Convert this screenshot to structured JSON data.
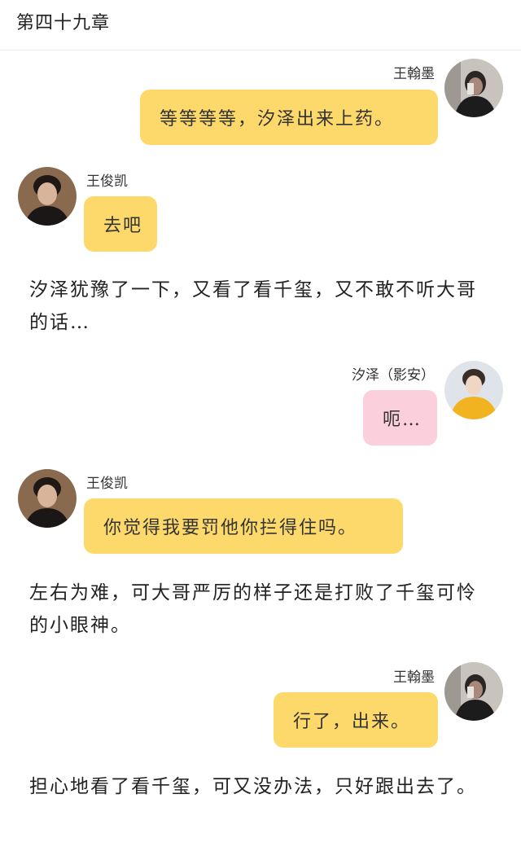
{
  "chapter": {
    "title": "第四十九章"
  },
  "messages": [
    {
      "speaker": "王翰墨",
      "text": "等等等等，汐泽出来上药。",
      "side": "right",
      "color": "yellow",
      "avatar": "boy-dark-jacket-avatar"
    },
    {
      "speaker": "王俊凯",
      "text": "去吧",
      "side": "left",
      "color": "yellow",
      "avatar": "boy-portrait-avatar"
    },
    {
      "speaker": "汐泽（影安）",
      "text": "呃…",
      "side": "right",
      "color": "pink",
      "avatar": "boy-yellow-sweater-avatar"
    },
    {
      "speaker": "王俊凯",
      "text": "你觉得我要罚他你拦得住吗。",
      "side": "left",
      "color": "yellow",
      "avatar": "boy-portrait-avatar"
    },
    {
      "speaker": "王翰墨",
      "text": "行了，出来。",
      "side": "right",
      "color": "yellow",
      "avatar": "boy-dark-jacket-avatar"
    }
  ],
  "narrations": [
    "汐泽犹豫了一下，又看了看千玺，又不敢不听大哥的话…",
    "左右为难，可大哥严厉的样子还是打败了千玺可怜的小眼神。",
    "担心地看了看千玺，可又没办法，只好跟出去了。"
  ],
  "colors": {
    "yellow_bubble": "#fcd96a",
    "pink_bubble": "#fbcfdc"
  }
}
